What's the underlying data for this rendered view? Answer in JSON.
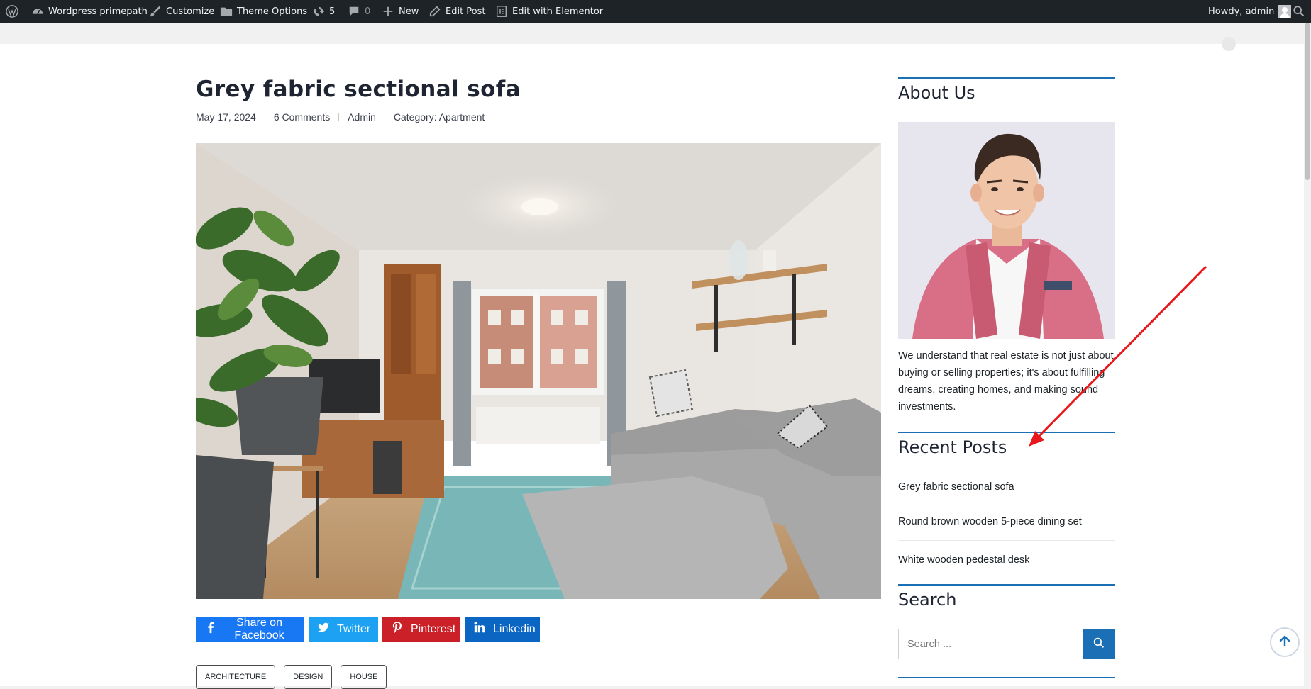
{
  "adminbar": {
    "site_name": "Wordpress primepath",
    "customize": "Customize",
    "theme_options": "Theme Options",
    "updates_count": "5",
    "comments_count": "0",
    "new": "New",
    "edit_post": "Edit Post",
    "edit_elementor": "Edit with Elementor",
    "howdy": "Howdy, admin"
  },
  "post": {
    "title": "Grey fabric sectional sofa",
    "date": "May 17, 2024",
    "comments": "6 Comments",
    "author": "Admin",
    "category": "Category: Apartment"
  },
  "share": {
    "facebook": "Share on Facebook",
    "twitter": "Twitter",
    "pinterest": "Pinterest",
    "linkedin": "Linkedin"
  },
  "tags": [
    "ARCHITECTURE",
    "DESIGN",
    "HOUSE"
  ],
  "sidebar": {
    "about_title": "About Us",
    "about_text": "We understand that real estate is not just about buying or selling properties; it's about fulfilling dreams, creating homes, and making sound investments.",
    "recent_title": "Recent Posts",
    "recent_posts": [
      "Grey fabric sectional sofa",
      "Round brown wooden 5-piece dining set",
      "White wooden pedestal desk"
    ],
    "search_title": "Search",
    "search_placeholder": "Search ..."
  },
  "colors": {
    "adminbar_bg": "#1d2327",
    "accent": "#1b6fb5",
    "facebook": "#1877f2",
    "twitter": "#1da1f2",
    "pinterest": "#cb2027",
    "linkedin": "#0a66c2",
    "annotation_arrow": "#e8171b"
  }
}
